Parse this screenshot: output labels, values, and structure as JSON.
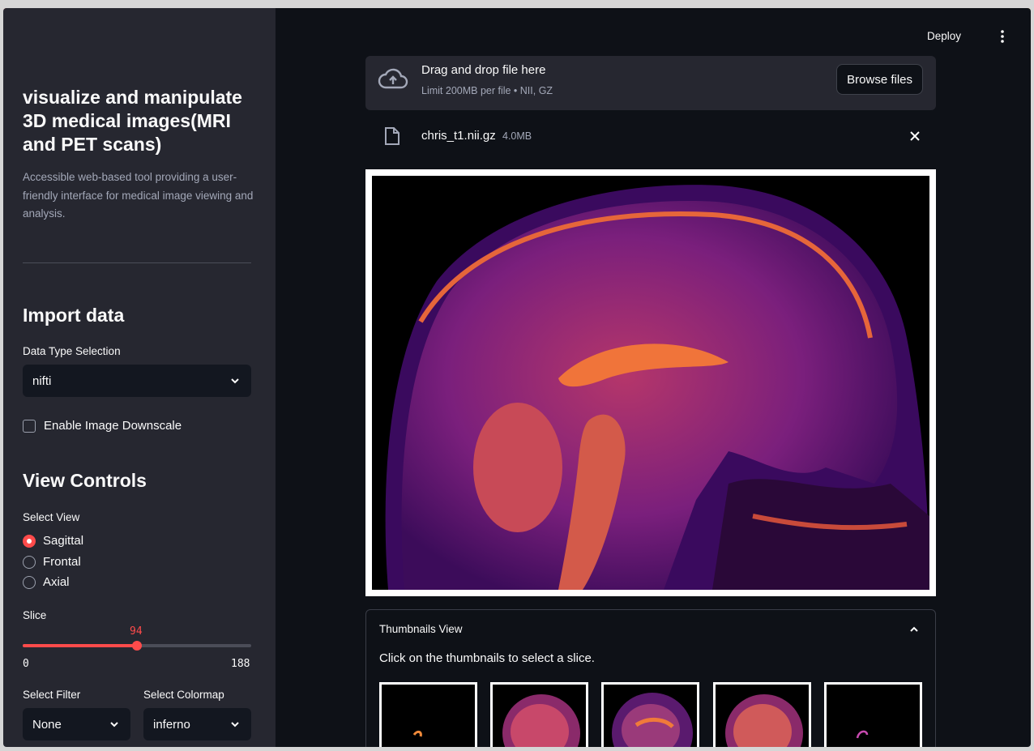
{
  "sidebar": {
    "title": "visualize and manipulate 3D medical images(MRI and PET scans)",
    "description": "Accessible web-based tool providing a user-friendly interface for medical image viewing and analysis.",
    "import_heading": "Import data",
    "data_type_label": "Data Type Selection",
    "data_type_value": "nifti",
    "downscale_label": "Enable Image Downscale",
    "view_heading": "View Controls",
    "select_view_label": "Select View",
    "views": [
      "Sagittal",
      "Frontal",
      "Axial"
    ],
    "selected_view": "Sagittal",
    "slice_label": "Slice",
    "slice_value": "94",
    "slice_min": "0",
    "slice_max": "188",
    "filter_label": "Select Filter",
    "filter_value": "None",
    "colormap_label": "Select Colormap",
    "colormap_value": "inferno"
  },
  "header": {
    "deploy_label": "Deploy"
  },
  "uploader": {
    "title": "Drag and drop file here",
    "subtitle": "Limit 200MB per file • NII, GZ",
    "browse_label": "Browse files",
    "file_name": "chris_t1.nii.gz",
    "file_size": "4.0MB"
  },
  "thumbnails": {
    "heading": "Thumbnails View",
    "hint": "Click on the thumbnails to select a slice."
  },
  "colors": {
    "accent": "#ff4b4b",
    "sidebar_bg": "#262730",
    "main_bg": "#0e1117"
  }
}
